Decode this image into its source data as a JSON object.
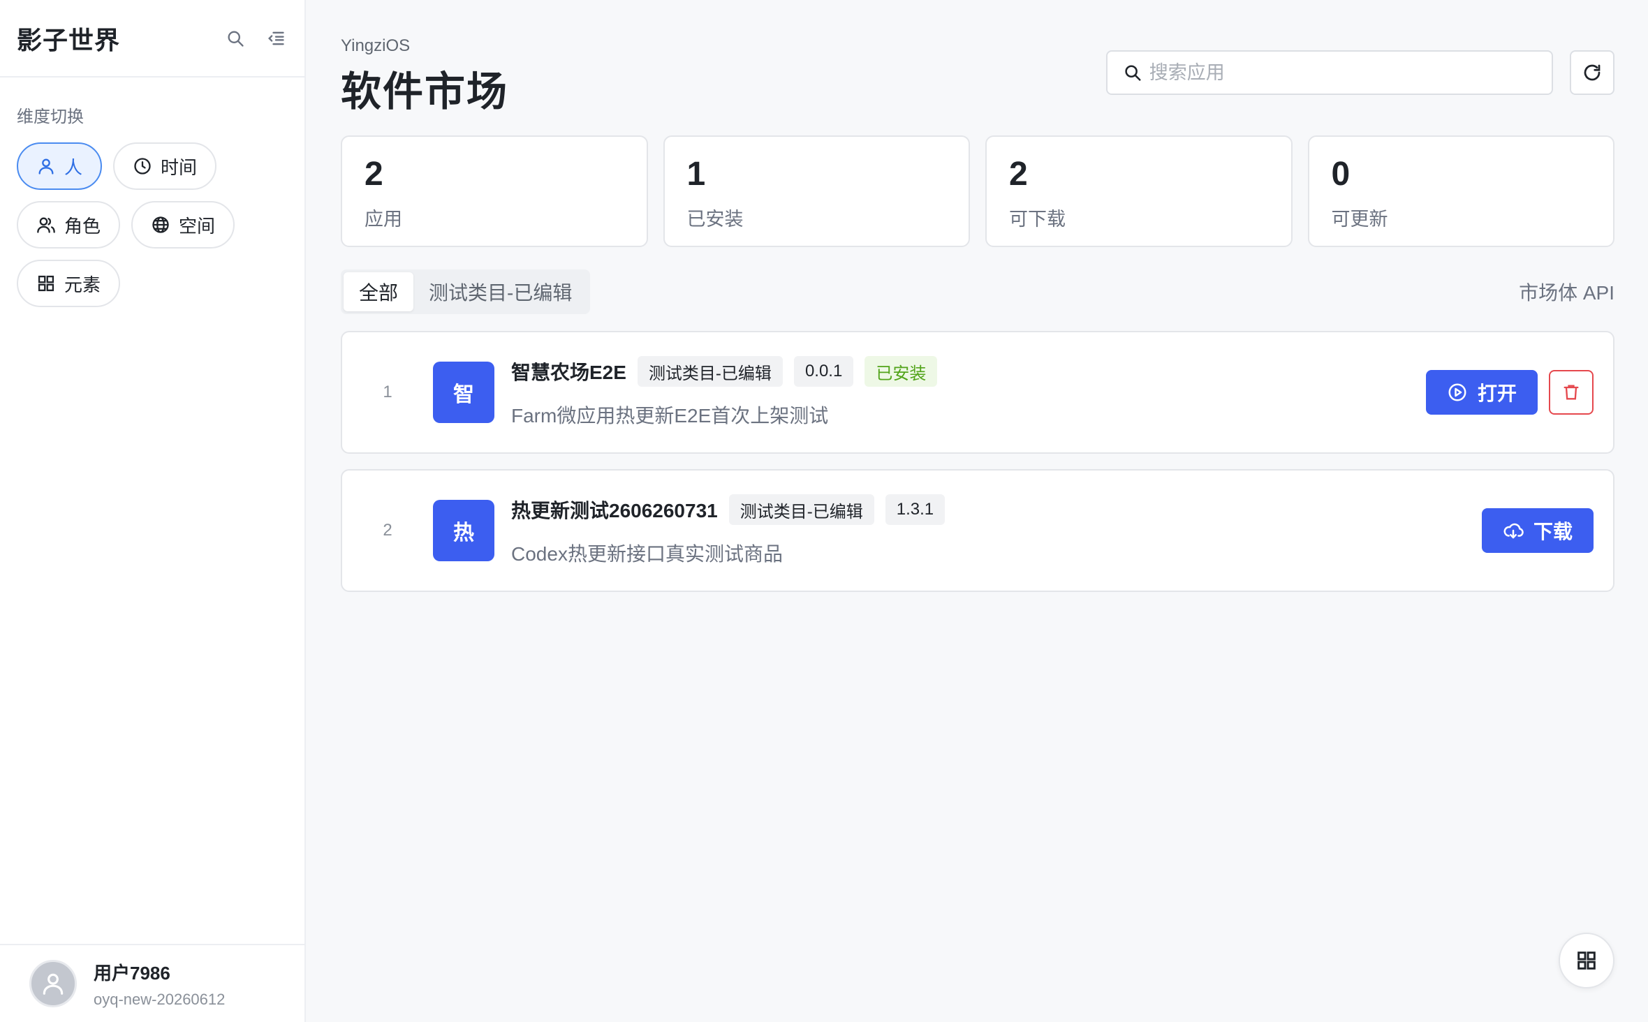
{
  "sidebar": {
    "brand": "影子世界",
    "section_label": "维度切换",
    "chips": [
      {
        "label": "人",
        "icon": "person-icon",
        "active": true
      },
      {
        "label": "时间",
        "icon": "clock-icon",
        "active": false
      },
      {
        "label": "角色",
        "icon": "users-icon",
        "active": false
      },
      {
        "label": "空间",
        "icon": "globe-icon",
        "active": false
      },
      {
        "label": "元素",
        "icon": "grid-icon",
        "active": false
      }
    ],
    "user": {
      "name": "用户7986",
      "handle": "oyq-new-20260612"
    }
  },
  "header": {
    "overline": "YingziOS",
    "title": "软件市场",
    "search_placeholder": "搜索应用",
    "search_value": ""
  },
  "stats": [
    {
      "value": "2",
      "label": "应用"
    },
    {
      "value": "1",
      "label": "已安装"
    },
    {
      "value": "2",
      "label": "可下载"
    },
    {
      "value": "0",
      "label": "可更新"
    }
  ],
  "tabs": [
    {
      "label": "全部",
      "active": true
    },
    {
      "label": "测试类目-已编辑",
      "active": false
    }
  ],
  "api_link": "市场体 API",
  "apps": [
    {
      "index": "1",
      "icon_char": "智",
      "name": "智慧农场E2E",
      "category": "测试类目-已编辑",
      "version": "0.0.1",
      "status": "已安装",
      "description": "Farm微应用热更新E2E首次上架测试",
      "action_label": "打开"
    },
    {
      "index": "2",
      "icon_char": "热",
      "name": "热更新测试2606260731",
      "category": "测试类目-已编辑",
      "version": "1.3.1",
      "status": "",
      "description": "Codex热更新接口真实测试商品",
      "action_label": "下载"
    }
  ],
  "colors": {
    "accent": "#3c5ef0",
    "danger": "#e5484d",
    "installed": "#52a41a",
    "active_chip": "#2f6fe4"
  }
}
